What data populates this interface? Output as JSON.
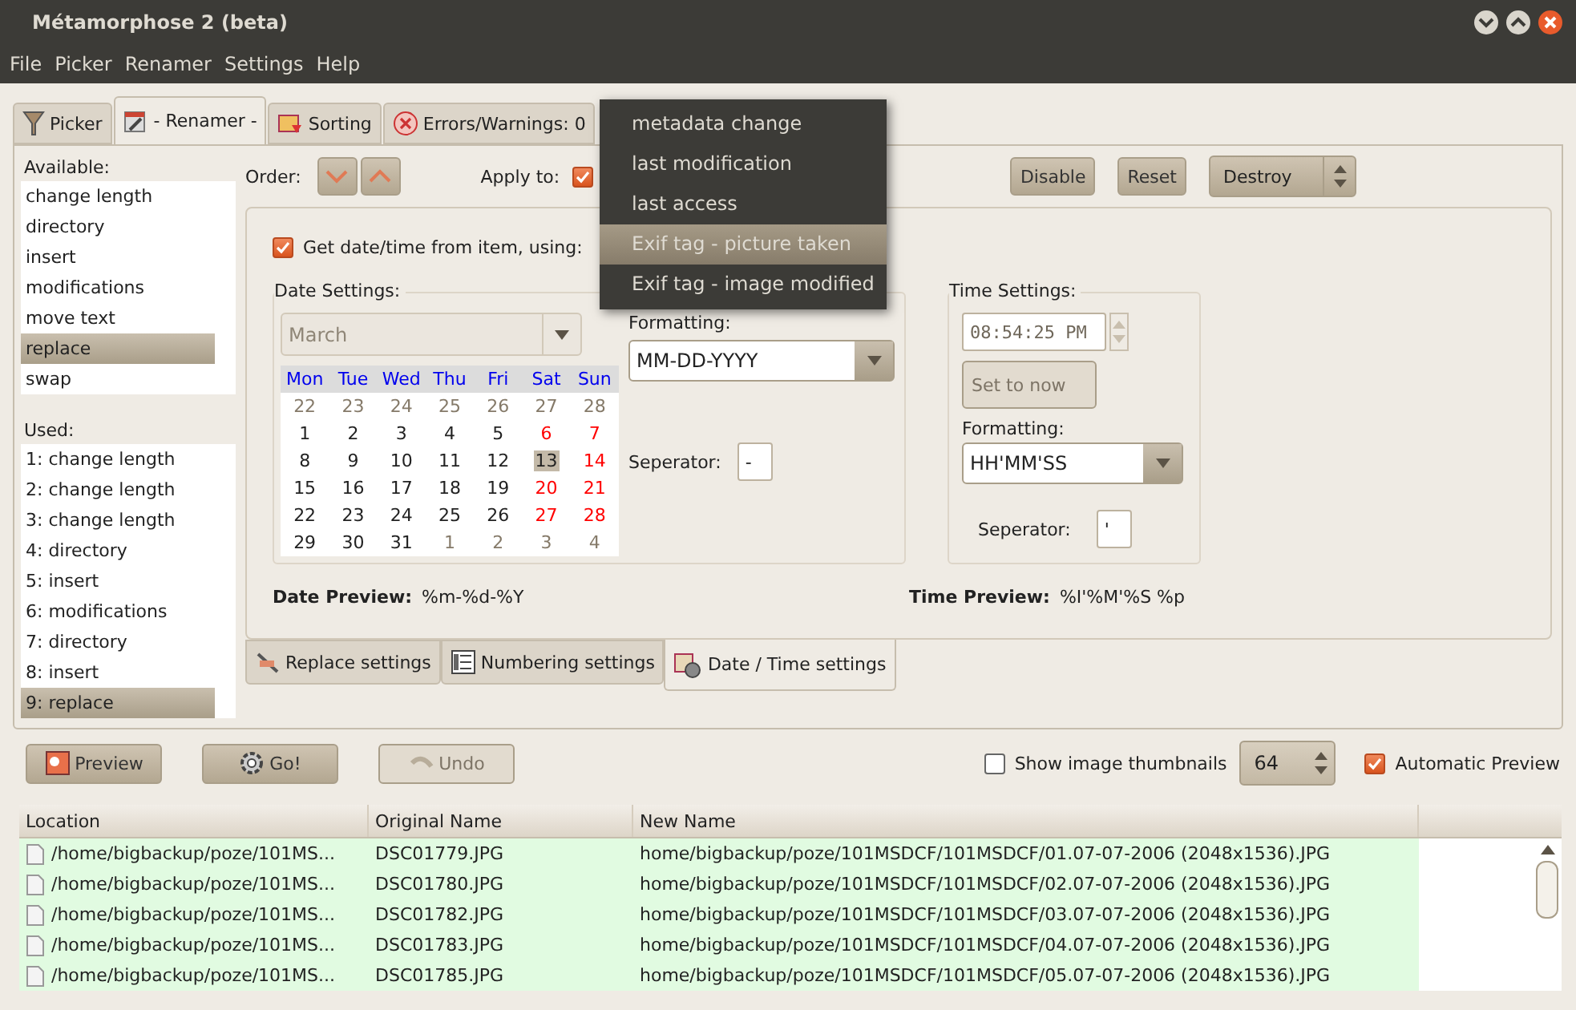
{
  "window": {
    "title": "Métamorphose 2 (beta)"
  },
  "menu": [
    "File",
    "Picker",
    "Renamer",
    "Settings",
    "Help"
  ],
  "tabs": [
    {
      "label": "Picker",
      "selected": false
    },
    {
      "label": "- Renamer -",
      "selected": true
    },
    {
      "label": "Sorting",
      "selected": false
    },
    {
      "label": "Errors/Warnings: 0",
      "selected": false
    }
  ],
  "available": {
    "label": "Available:",
    "items": [
      {
        "label": "change length",
        "selected": false
      },
      {
        "label": "directory",
        "selected": false
      },
      {
        "label": "insert",
        "selected": false
      },
      {
        "label": "modifications",
        "selected": false
      },
      {
        "label": "move text",
        "selected": false
      },
      {
        "label": "replace",
        "selected": true
      },
      {
        "label": "swap",
        "selected": false
      }
    ]
  },
  "used": {
    "label": "Used:",
    "items": [
      {
        "label": "1: change length",
        "selected": false
      },
      {
        "label": "2: change length",
        "selected": false
      },
      {
        "label": "3: change length",
        "selected": false
      },
      {
        "label": "4: directory",
        "selected": false
      },
      {
        "label": "5: insert",
        "selected": false
      },
      {
        "label": "6: modifications",
        "selected": false
      },
      {
        "label": "7: directory",
        "selected": false
      },
      {
        "label": "8: insert",
        "selected": false
      },
      {
        "label": "9: replace",
        "selected": true
      }
    ]
  },
  "order": {
    "label": "Order:"
  },
  "apply_to": {
    "label": "Apply to:",
    "checked": true
  },
  "buttons": [
    {
      "label": "Disable"
    },
    {
      "label": "Reset"
    }
  ],
  "destroy_select": {
    "value": "Destroy"
  },
  "get_datetime": {
    "label": "Get date/time from item, using:",
    "checked": true
  },
  "source_menu": [
    {
      "label": "metadata change",
      "selected": false
    },
    {
      "label": "last modification",
      "selected": false
    },
    {
      "label": "last access",
      "selected": false
    },
    {
      "label": "Exif tag - picture taken",
      "selected": true
    },
    {
      "label": "Exif tag - image modified",
      "selected": false
    }
  ],
  "date_settings": {
    "title": "Date Settings:",
    "month": {
      "value": "March",
      "disabled": true
    },
    "weekdays": [
      "Mon",
      "Tue",
      "Wed",
      "Thu",
      "Fri",
      "Sat",
      "Sun"
    ],
    "weeks": [
      [
        {
          "label": "22",
          "kind": "other",
          "selected": false
        },
        {
          "label": "23",
          "kind": "other",
          "selected": false
        },
        {
          "label": "24",
          "kind": "other",
          "selected": false
        },
        {
          "label": "25",
          "kind": "other",
          "selected": false
        },
        {
          "label": "26",
          "kind": "other",
          "selected": false
        },
        {
          "label": "27",
          "kind": "other",
          "selected": false
        },
        {
          "label": "28",
          "kind": "other",
          "selected": false
        }
      ],
      [
        {
          "label": "1",
          "kind": "day",
          "selected": false
        },
        {
          "label": "2",
          "kind": "day",
          "selected": false
        },
        {
          "label": "3",
          "kind": "day",
          "selected": false
        },
        {
          "label": "4",
          "kind": "day",
          "selected": false
        },
        {
          "label": "5",
          "kind": "day",
          "selected": false
        },
        {
          "label": "6",
          "kind": "weekend",
          "selected": false
        },
        {
          "label": "7",
          "kind": "weekend",
          "selected": false
        }
      ],
      [
        {
          "label": "8",
          "kind": "day",
          "selected": false
        },
        {
          "label": "9",
          "kind": "day",
          "selected": false
        },
        {
          "label": "10",
          "kind": "day",
          "selected": false
        },
        {
          "label": "11",
          "kind": "day",
          "selected": false
        },
        {
          "label": "12",
          "kind": "day",
          "selected": false
        },
        {
          "label": "13",
          "kind": "day",
          "selected": true
        },
        {
          "label": "14",
          "kind": "weekend",
          "selected": false
        }
      ],
      [
        {
          "label": "15",
          "kind": "day",
          "selected": false
        },
        {
          "label": "16",
          "kind": "day",
          "selected": false
        },
        {
          "label": "17",
          "kind": "day",
          "selected": false
        },
        {
          "label": "18",
          "kind": "day",
          "selected": false
        },
        {
          "label": "19",
          "kind": "day",
          "selected": false
        },
        {
          "label": "20",
          "kind": "weekend",
          "selected": false
        },
        {
          "label": "21",
          "kind": "weekend",
          "selected": false
        }
      ],
      [
        {
          "label": "22",
          "kind": "day",
          "selected": false
        },
        {
          "label": "23",
          "kind": "day",
          "selected": false
        },
        {
          "label": "24",
          "kind": "day",
          "selected": false
        },
        {
          "label": "25",
          "kind": "day",
          "selected": false
        },
        {
          "label": "26",
          "kind": "day",
          "selected": false
        },
        {
          "label": "27",
          "kind": "weekend",
          "selected": false
        },
        {
          "label": "28",
          "kind": "weekend",
          "selected": false
        }
      ],
      [
        {
          "label": "29",
          "kind": "day",
          "selected": false
        },
        {
          "label": "30",
          "kind": "day",
          "selected": false
        },
        {
          "label": "31",
          "kind": "day",
          "selected": false
        },
        {
          "label": "1",
          "kind": "other",
          "selected": false
        },
        {
          "label": "2",
          "kind": "other",
          "selected": false
        },
        {
          "label": "3",
          "kind": "other",
          "selected": false
        },
        {
          "label": "4",
          "kind": "other",
          "selected": false
        }
      ]
    ],
    "formatting": {
      "label": "Formatting:",
      "value": "MM-DD-YYYY"
    },
    "separator": {
      "label": "Seperator:",
      "value": "-"
    }
  },
  "time_settings": {
    "title": "Time Settings:",
    "time": {
      "value": "08:54:25 PM",
      "disabled": true
    },
    "set_now": {
      "label": "Set to now",
      "disabled": true
    },
    "formatting": {
      "label": "Formatting:",
      "value": "HH'MM'SS"
    },
    "separator": {
      "label": "Seperator:",
      "value": "'"
    }
  },
  "date_preview": {
    "label": "Date Preview:",
    "value": "%m-%d-%Y"
  },
  "time_preview": {
    "label": "Time Preview:",
    "value": "%I'%M'%S %p"
  },
  "sub_tabs": [
    {
      "label": "Replace settings",
      "selected": false
    },
    {
      "label": "Numbering settings",
      "selected": false
    },
    {
      "label": "Date / Time settings",
      "selected": true
    }
  ],
  "actions": [
    {
      "label": "Preview",
      "disabled": false
    },
    {
      "label": "Go!",
      "disabled": false
    },
    {
      "label": "Undo",
      "disabled": true
    }
  ],
  "thumbnails": {
    "label": "Show image thumbnails",
    "checked": false
  },
  "thumb_size": {
    "value": "64"
  },
  "auto_preview": {
    "label": "Automatic Preview",
    "checked": true
  },
  "table": {
    "columns": [
      "Location",
      "Original Name",
      "New Name"
    ],
    "rows": [
      [
        "/home/bigbackup/poze/101MS...",
        "DSC01779.JPG",
        "home/bigbackup/poze/101MSDCF/101MSDCF/01.07-07-2006 (2048x1536).JPG"
      ],
      [
        "/home/bigbackup/poze/101MS...",
        "DSC01780.JPG",
        "home/bigbackup/poze/101MSDCF/101MSDCF/02.07-07-2006 (2048x1536).JPG"
      ],
      [
        "/home/bigbackup/poze/101MS...",
        "DSC01782.JPG",
        "home/bigbackup/poze/101MSDCF/101MSDCF/03.07-07-2006 (2048x1536).JPG"
      ],
      [
        "/home/bigbackup/poze/101MS...",
        "DSC01783.JPG",
        "home/bigbackup/poze/101MSDCF/101MSDCF/04.07-07-2006 (2048x1536).JPG"
      ],
      [
        "/home/bigbackup/poze/101MS...",
        "DSC01785.JPG",
        "home/bigbackup/poze/101MSDCF/101MSDCF/05.07-07-2006 (2048x1536).JPG"
      ]
    ]
  }
}
